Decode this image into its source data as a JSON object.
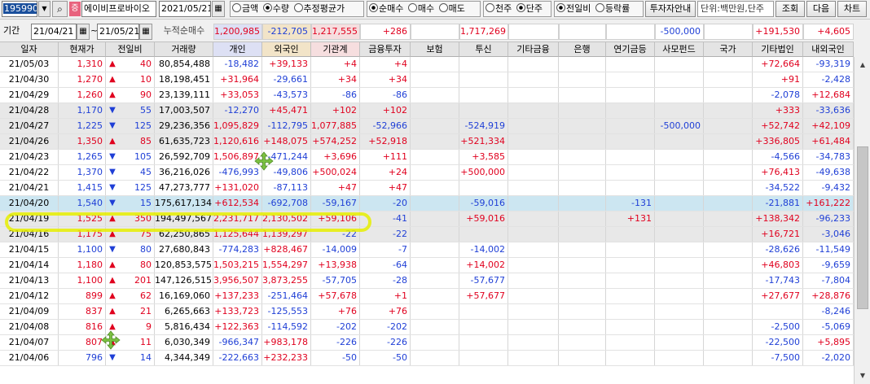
{
  "toolbar": {
    "stock_code": "195990",
    "dropdown_icon": "chevron-down-icon",
    "search_icon": "search-icon",
    "badge": "증",
    "stock_name": "에이비프로바이오",
    "date": "2021/05/21",
    "group1": [
      "금액",
      "수량",
      "추정평균가"
    ],
    "group1_selected": 1,
    "group2": [
      "순매수",
      "매수",
      "매도"
    ],
    "group2_selected": 0,
    "group3": [
      "천주",
      "단주"
    ],
    "group3_selected": 1,
    "group4": [
      "전일비",
      "등락률"
    ],
    "group4_selected": 0,
    "guide_button": "투자자안내",
    "unit_label": "단위:백만원,단주",
    "query_button": "조회",
    "next_button": "다음",
    "chart_button": "차트"
  },
  "filter": {
    "period_label": "기간",
    "start_date": "21/04/21",
    "tilde": "~",
    "end_date": "21/05/21",
    "total_label": "누적순매수",
    "totals": {
      "retail": "1,200,985",
      "foreign": "-212,705",
      "inst": "1,217,555",
      "fin": "+286",
      "ins": "",
      "trust": "1,717,269",
      "etcfin": "",
      "bank": "",
      "pension": "",
      "pef": "-500,000",
      "nation": "",
      "etccorp": "+191,530",
      "domfor": "+4,605"
    }
  },
  "columns": {
    "date": "일자",
    "price": "현재가",
    "change": "전일비",
    "volume": "거래량",
    "retail": "개인",
    "foreign": "외국인",
    "inst": "기관계",
    "fin": "금융투자",
    "ins": "보험",
    "trust": "투신",
    "etcfin": "기타금융",
    "bank": "은행",
    "pension": "연기금등",
    "pef": "사모펀드",
    "nation": "국가",
    "etccorp": "기타법인",
    "domfor": "내외국인"
  },
  "rows": [
    {
      "date": "21/05/03",
      "price": "1,310",
      "dir": "up",
      "chg": "40",
      "vol": "80,854,488",
      "retail": "-18,482",
      "foreign": "+39,133",
      "inst": "+4",
      "fin": "+4",
      "ins": "",
      "trust": "",
      "etcfin": "",
      "bank": "",
      "pension": "",
      "pef": "",
      "nation": "",
      "etccorp": "+72,664",
      "domfor": "-93,319"
    },
    {
      "date": "21/04/30",
      "price": "1,270",
      "dir": "up",
      "chg": "10",
      "vol": "18,198,451",
      "retail": "+31,964",
      "foreign": "-29,661",
      "inst": "+34",
      "fin": "+34",
      "ins": "",
      "trust": "",
      "etcfin": "",
      "bank": "",
      "pension": "",
      "pef": "",
      "nation": "",
      "etccorp": "+91",
      "domfor": "-2,428"
    },
    {
      "date": "21/04/29",
      "price": "1,260",
      "dir": "up",
      "chg": "90",
      "vol": "23,139,111",
      "retail": "+33,053",
      "foreign": "-43,573",
      "inst": "-86",
      "fin": "-86",
      "ins": "",
      "trust": "",
      "etcfin": "",
      "bank": "",
      "pension": "",
      "pef": "",
      "nation": "",
      "etccorp": "-2,078",
      "domfor": "+12,684"
    },
    {
      "date": "21/04/28",
      "price": "1,170",
      "dir": "down",
      "chg": "55",
      "vol": "17,003,507",
      "retail": "-12,270",
      "foreign": "+45,471",
      "inst": "+102",
      "fin": "+102",
      "ins": "",
      "trust": "",
      "etcfin": "",
      "bank": "",
      "pension": "",
      "pef": "",
      "nation": "",
      "etccorp": "+333",
      "domfor": "-33,636"
    },
    {
      "date": "21/04/27",
      "price": "1,225",
      "dir": "down",
      "chg": "125",
      "vol": "29,236,356",
      "retail": "1,095,829",
      "foreign": "-112,795",
      "inst": "1,077,885",
      "fin": "-52,966",
      "ins": "",
      "trust": "-524,919",
      "etcfin": "",
      "bank": "",
      "pension": "",
      "pef": "-500,000",
      "nation": "",
      "etccorp": "+52,742",
      "domfor": "+42,109"
    },
    {
      "date": "21/04/26",
      "price": "1,350",
      "dir": "up",
      "chg": "85",
      "vol": "61,635,723",
      "retail": "1,120,616",
      "foreign": "+148,075",
      "inst": "+574,252",
      "fin": "+52,918",
      "ins": "",
      "trust": "+521,334",
      "etcfin": "",
      "bank": "",
      "pension": "",
      "pef": "",
      "nation": "",
      "etccorp": "+336,805",
      "domfor": "+61,484"
    },
    {
      "date": "21/04/23",
      "price": "1,265",
      "dir": "down",
      "chg": "105",
      "vol": "26,592,709",
      "retail": "1,506,897",
      "foreign": "-471,244",
      "inst": "+3,696",
      "fin": "+111",
      "ins": "",
      "trust": "+3,585",
      "etcfin": "",
      "bank": "",
      "pension": "",
      "pef": "",
      "nation": "",
      "etccorp": "-4,566",
      "domfor": "-34,783"
    },
    {
      "date": "21/04/22",
      "price": "1,370",
      "dir": "down",
      "chg": "45",
      "vol": "36,216,026",
      "retail": "-476,993",
      "foreign": "-49,806",
      "inst": "+500,024",
      "fin": "+24",
      "ins": "",
      "trust": "+500,000",
      "etcfin": "",
      "bank": "",
      "pension": "",
      "pef": "",
      "nation": "",
      "etccorp": "+76,413",
      "domfor": "-49,638"
    },
    {
      "date": "21/04/21",
      "price": "1,415",
      "dir": "down",
      "chg": "125",
      "vol": "47,273,777",
      "retail": "+131,020",
      "foreign": "-87,113",
      "inst": "+47",
      "fin": "+47",
      "ins": "",
      "trust": "",
      "etcfin": "",
      "bank": "",
      "pension": "",
      "pef": "",
      "nation": "",
      "etccorp": "-34,522",
      "domfor": "-9,432"
    },
    {
      "date": "21/04/20",
      "price": "1,540",
      "dir": "down",
      "chg": "15",
      "vol": "175,617,134",
      "retail": "+612,534",
      "foreign": "-692,708",
      "inst": "-59,167",
      "fin": "-20",
      "ins": "",
      "trust": "-59,016",
      "etcfin": "",
      "bank": "",
      "pension": "-131",
      "pef": "",
      "nation": "",
      "etccorp": "-21,881",
      "domfor": "+161,222"
    },
    {
      "date": "21/04/19",
      "price": "1,525",
      "dir": "up",
      "chg": "350",
      "vol": "194,497,567",
      "retail": "2,231,717",
      "foreign": "2,130,502",
      "inst": "+59,106",
      "fin": "-41",
      "ins": "",
      "trust": "+59,016",
      "etcfin": "",
      "bank": "",
      "pension": "+131",
      "pef": "",
      "nation": "",
      "etccorp": "+138,342",
      "domfor": "-96,233"
    },
    {
      "date": "21/04/16",
      "price": "1,175",
      "dir": "up",
      "chg": "75",
      "vol": "62,250,865",
      "retail": "1,125,644",
      "foreign": "1,139,297",
      "inst": "-22",
      "fin": "-22",
      "ins": "",
      "trust": "",
      "etcfin": "",
      "bank": "",
      "pension": "",
      "pef": "",
      "nation": "",
      "etccorp": "+16,721",
      "domfor": "-3,046"
    },
    {
      "date": "21/04/15",
      "price": "1,100",
      "dir": "down",
      "chg": "80",
      "vol": "27,680,843",
      "retail": "-774,283",
      "foreign": "+828,467",
      "inst": "-14,009",
      "fin": "-7",
      "ins": "",
      "trust": "-14,002",
      "etcfin": "",
      "bank": "",
      "pension": "",
      "pef": "",
      "nation": "",
      "etccorp": "-28,626",
      "domfor": "-11,549"
    },
    {
      "date": "21/04/14",
      "price": "1,180",
      "dir": "up",
      "chg": "80",
      "vol": "120,853,575",
      "retail": "1,503,215",
      "foreign": "1,554,297",
      "inst": "+13,938",
      "fin": "-64",
      "ins": "",
      "trust": "+14,002",
      "etcfin": "",
      "bank": "",
      "pension": "",
      "pef": "",
      "nation": "",
      "etccorp": "+46,803",
      "domfor": "-9,659"
    },
    {
      "date": "21/04/13",
      "price": "1,100",
      "dir": "up",
      "chg": "201",
      "vol": "147,126,515",
      "retail": "3,956,507",
      "foreign": "3,873,255",
      "inst": "-57,705",
      "fin": "-28",
      "ins": "",
      "trust": "-57,677",
      "etcfin": "",
      "bank": "",
      "pension": "",
      "pef": "",
      "nation": "",
      "etccorp": "-17,743",
      "domfor": "-7,804"
    },
    {
      "date": "21/04/12",
      "price": "899",
      "dir": "up",
      "chg": "62",
      "vol": "16,169,060",
      "retail": "+137,233",
      "foreign": "-251,464",
      "inst": "+57,678",
      "fin": "+1",
      "ins": "",
      "trust": "+57,677",
      "etcfin": "",
      "bank": "",
      "pension": "",
      "pef": "",
      "nation": "",
      "etccorp": "+27,677",
      "domfor": "+28,876"
    },
    {
      "date": "21/04/09",
      "price": "837",
      "dir": "up",
      "chg": "21",
      "vol": "6,265,663",
      "retail": "+133,723",
      "foreign": "-125,553",
      "inst": "+76",
      "fin": "+76",
      "ins": "",
      "trust": "",
      "etcfin": "",
      "bank": "",
      "pension": "",
      "pef": "",
      "nation": "",
      "etccorp": "",
      "domfor": "-8,246"
    },
    {
      "date": "21/04/08",
      "price": "816",
      "dir": "up",
      "chg": "9",
      "vol": "5,816,434",
      "retail": "+122,363",
      "foreign": "-114,592",
      "inst": "-202",
      "fin": "-202",
      "ins": "",
      "trust": "",
      "etcfin": "",
      "bank": "",
      "pension": "",
      "pef": "",
      "nation": "",
      "etccorp": "-2,500",
      "domfor": "-5,069"
    },
    {
      "date": "21/04/07",
      "price": "807",
      "dir": "up",
      "chg": "11",
      "vol": "6,030,349",
      "retail": "-966,347",
      "foreign": "+983,178",
      "inst": "-226",
      "fin": "-226",
      "ins": "",
      "trust": "",
      "etcfin": "",
      "bank": "",
      "pension": "",
      "pef": "",
      "nation": "",
      "etccorp": "-22,500",
      "domfor": "+5,895"
    },
    {
      "date": "21/04/06",
      "price": "796",
      "dir": "down",
      "chg": "14",
      "vol": "4,344,349",
      "retail": "-222,663",
      "foreign": "+232,233",
      "inst": "-50",
      "fin": "-50",
      "ins": "",
      "trust": "",
      "etcfin": "",
      "bank": "",
      "pension": "",
      "pef": "",
      "nation": "",
      "etccorp": "-7,500",
      "domfor": "-2,020"
    }
  ],
  "colors": {
    "up": "#e0001e",
    "down": "#1f3fd6",
    "highlight": "#e6ee00",
    "cursor": "#7cc242"
  }
}
